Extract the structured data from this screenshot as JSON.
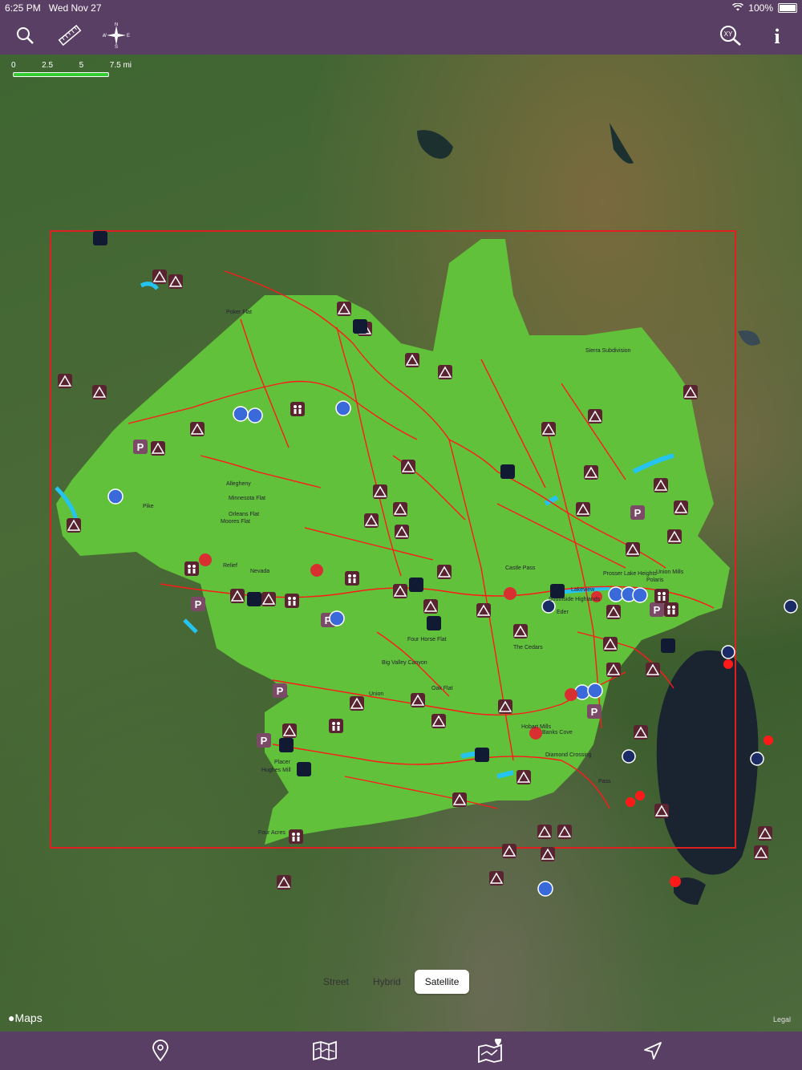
{
  "status": {
    "time": "6:25 PM",
    "date": "Wed Nov 27",
    "battery": "100%"
  },
  "toolbar": {
    "icons": [
      "search-icon",
      "ruler-icon",
      "compass-icon",
      "xy-coordinates-icon",
      "info-icon"
    ],
    "xy_label": "XY",
    "info_label": "i",
    "compass": {
      "n": "N",
      "s": "S",
      "e": "E",
      "w": "W"
    }
  },
  "scale": {
    "labels": [
      "0",
      "2.5",
      "5",
      "7.5 mi"
    ]
  },
  "map": {
    "places": [
      "Poker Flat",
      "Sierra Subdivision",
      "Allegheny",
      "Minnesota Flat",
      "Orleans Flat",
      "Moores Flat",
      "Pike",
      "Relief",
      "Nevada",
      "Castle Pass",
      "Prosser Lake Heights",
      "Union Mills",
      "Polaris",
      "Lakeview",
      "Southside Highlands",
      "Eder",
      "The Cedars",
      "Four Horse Flat",
      "Big Valley Canyon",
      "Oak Flat",
      "Union",
      "Hughes Mill",
      "Placer",
      "Diamond Crossing",
      "Hobart Mills",
      "Banks Cove",
      "Pass",
      "Four Acres"
    ],
    "colors": {
      "forest": "#62c13a",
      "boundary": "#e02020",
      "roads": "#ff1a1a",
      "water": "#25c4f0",
      "campsite": "#5a2330"
    }
  },
  "map_types": {
    "street": "Street",
    "hybrid": "Hybrid",
    "satellite": "Satellite",
    "selected": "Satellite"
  },
  "attribution": {
    "maps": "Maps",
    "legal": "Legal"
  },
  "bottom_nav": {
    "icons": [
      "location-pin-icon",
      "map-icon",
      "map-route-icon",
      "navigation-arrow-icon"
    ]
  }
}
